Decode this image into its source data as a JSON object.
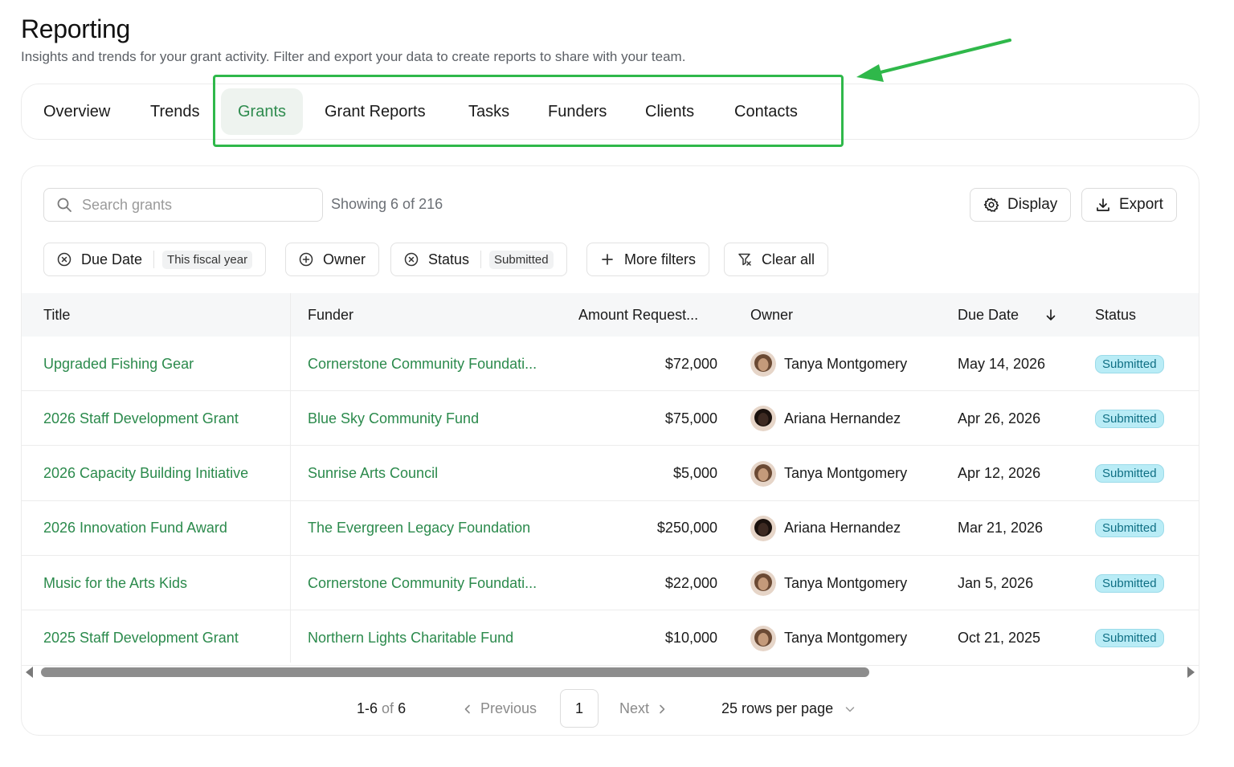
{
  "page": {
    "title": "Reporting",
    "subtitle": "Insights and trends for your grant activity. Filter and export your data to create reports to share with your team."
  },
  "tabs": [
    {
      "label": "Overview",
      "active": false
    },
    {
      "label": "Trends",
      "active": false
    },
    {
      "label": "Grants",
      "active": true
    },
    {
      "label": "Grant Reports",
      "active": false
    },
    {
      "label": "Tasks",
      "active": false
    },
    {
      "label": "Funders",
      "active": false
    },
    {
      "label": "Clients",
      "active": false
    },
    {
      "label": "Contacts",
      "active": false
    }
  ],
  "toolbar": {
    "search_placeholder": "Search grants",
    "showing_text": "Showing 6 of 216",
    "display_label": "Display",
    "export_label": "Export"
  },
  "filters": {
    "due_date_label": "Due Date",
    "due_date_value": "This fiscal year",
    "owner_label": "Owner",
    "status_label": "Status",
    "status_value": "Submitted",
    "more_filters_label": "More filters",
    "clear_all_label": "Clear all"
  },
  "table": {
    "headers": {
      "title": "Title",
      "funder": "Funder",
      "amount": "Amount Request...",
      "owner": "Owner",
      "due_date": "Due Date",
      "status": "Status"
    },
    "rows": [
      {
        "title": "Upgraded Fishing Gear",
        "funder": "Cornerstone Community Foundati...",
        "amount": "$72,000",
        "owner": "Tanya Montgomery",
        "due_date": "May 14, 2026",
        "status": "Submitted"
      },
      {
        "title": "2026 Staff Development Grant",
        "funder": "Blue Sky Community Fund",
        "amount": "$75,000",
        "owner": "Ariana Hernandez",
        "due_date": "Apr 26, 2026",
        "status": "Submitted"
      },
      {
        "title": "2026 Capacity Building Initiative",
        "funder": "Sunrise Arts Council",
        "amount": "$5,000",
        "owner": "Tanya Montgomery",
        "due_date": "Apr 12, 2026",
        "status": "Submitted"
      },
      {
        "title": "2026 Innovation Fund Award",
        "funder": "The Evergreen Legacy Foundation",
        "amount": "$250,000",
        "owner": "Ariana Hernandez",
        "due_date": "Mar 21, 2026",
        "status": "Submitted"
      },
      {
        "title": "Music for the Arts Kids",
        "funder": "Cornerstone Community Foundati...",
        "amount": "$22,000",
        "owner": "Tanya Montgomery",
        "due_date": "Jan 5, 2026",
        "status": "Submitted"
      },
      {
        "title": "2025 Staff Development Grant",
        "funder": "Northern Lights Charitable Fund",
        "amount": "$10,000",
        "owner": "Tanya Montgomery",
        "due_date": "Oct 21, 2025",
        "status": "Submitted"
      }
    ]
  },
  "pagination": {
    "range": "1-6",
    "of_label": "of",
    "total": "6",
    "previous_label": "Previous",
    "current_page": "1",
    "next_label": "Next",
    "rows_per_page_label": "25 rows per page"
  },
  "colors": {
    "accent_green": "#2b8a4c",
    "highlight_green": "#2fb84a",
    "badge_bg": "#b9ecf6",
    "badge_text": "#0f6f84"
  }
}
